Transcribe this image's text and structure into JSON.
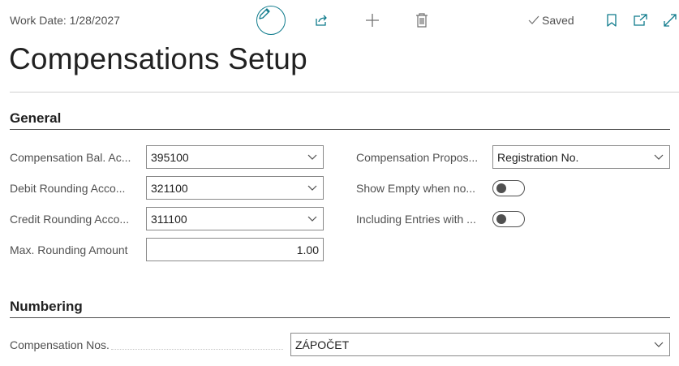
{
  "header": {
    "work_date": "Work Date: 1/28/2027",
    "saved_label": "Saved",
    "title": "Compensations Setup"
  },
  "toolbar": {
    "icons": [
      "pencil-icon",
      "share-icon",
      "plus-icon",
      "trash-icon",
      "bookmark-icon",
      "open-new-window-icon",
      "expand-icon"
    ]
  },
  "general": {
    "title": "General",
    "compensation_bal_account": {
      "label": "Compensation Bal. Ac...",
      "value": "395100"
    },
    "debit_rounding_account": {
      "label": "Debit Rounding Acco...",
      "value": "321100"
    },
    "credit_rounding_account": {
      "label": "Credit Rounding Acco...",
      "value": "311100"
    },
    "max_rounding_amount": {
      "label": "Max. Rounding Amount",
      "value": "1.00"
    },
    "compensation_proposal": {
      "label": "Compensation Propos...",
      "value": "Registration No."
    },
    "show_empty": {
      "label": "Show Empty when no...",
      "value": false
    },
    "including_entries": {
      "label": "Including Entries with ...",
      "value": false
    }
  },
  "numbering": {
    "title": "Numbering",
    "compensation_nos": {
      "label": "Compensation Nos.",
      "value": "ZÁPOČET"
    }
  },
  "colors": {
    "accent": "#0f7b8c",
    "label": "#505050"
  }
}
